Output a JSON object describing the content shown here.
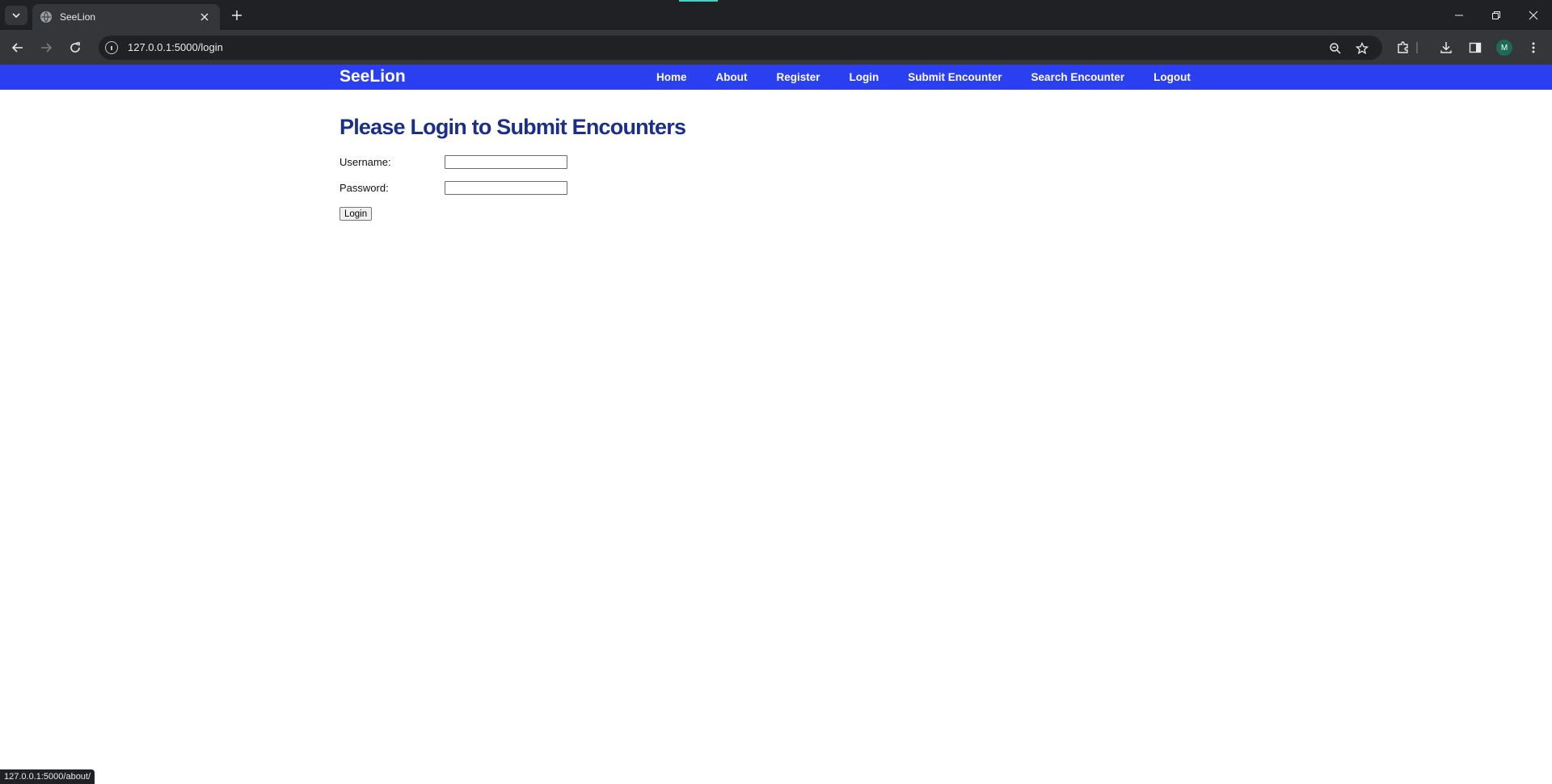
{
  "browser": {
    "tab_title": "SeeLion",
    "url": "127.0.0.1:5000/login",
    "profile_initial": "M",
    "status_url": "127.0.0.1:5000/about/"
  },
  "site": {
    "brand": "SeeLion",
    "nav": [
      "Home",
      "About",
      "Register",
      "Login",
      "Submit Encounter",
      "Search Encounter",
      "Logout"
    ]
  },
  "page": {
    "title": "Please Login to Submit Encounters",
    "username_label": "Username:",
    "username_value": "",
    "password_label": "Password:",
    "password_value": "",
    "login_button": "Login"
  },
  "colors": {
    "navbar": "#2a3ff0",
    "title": "#1a2f8a"
  }
}
